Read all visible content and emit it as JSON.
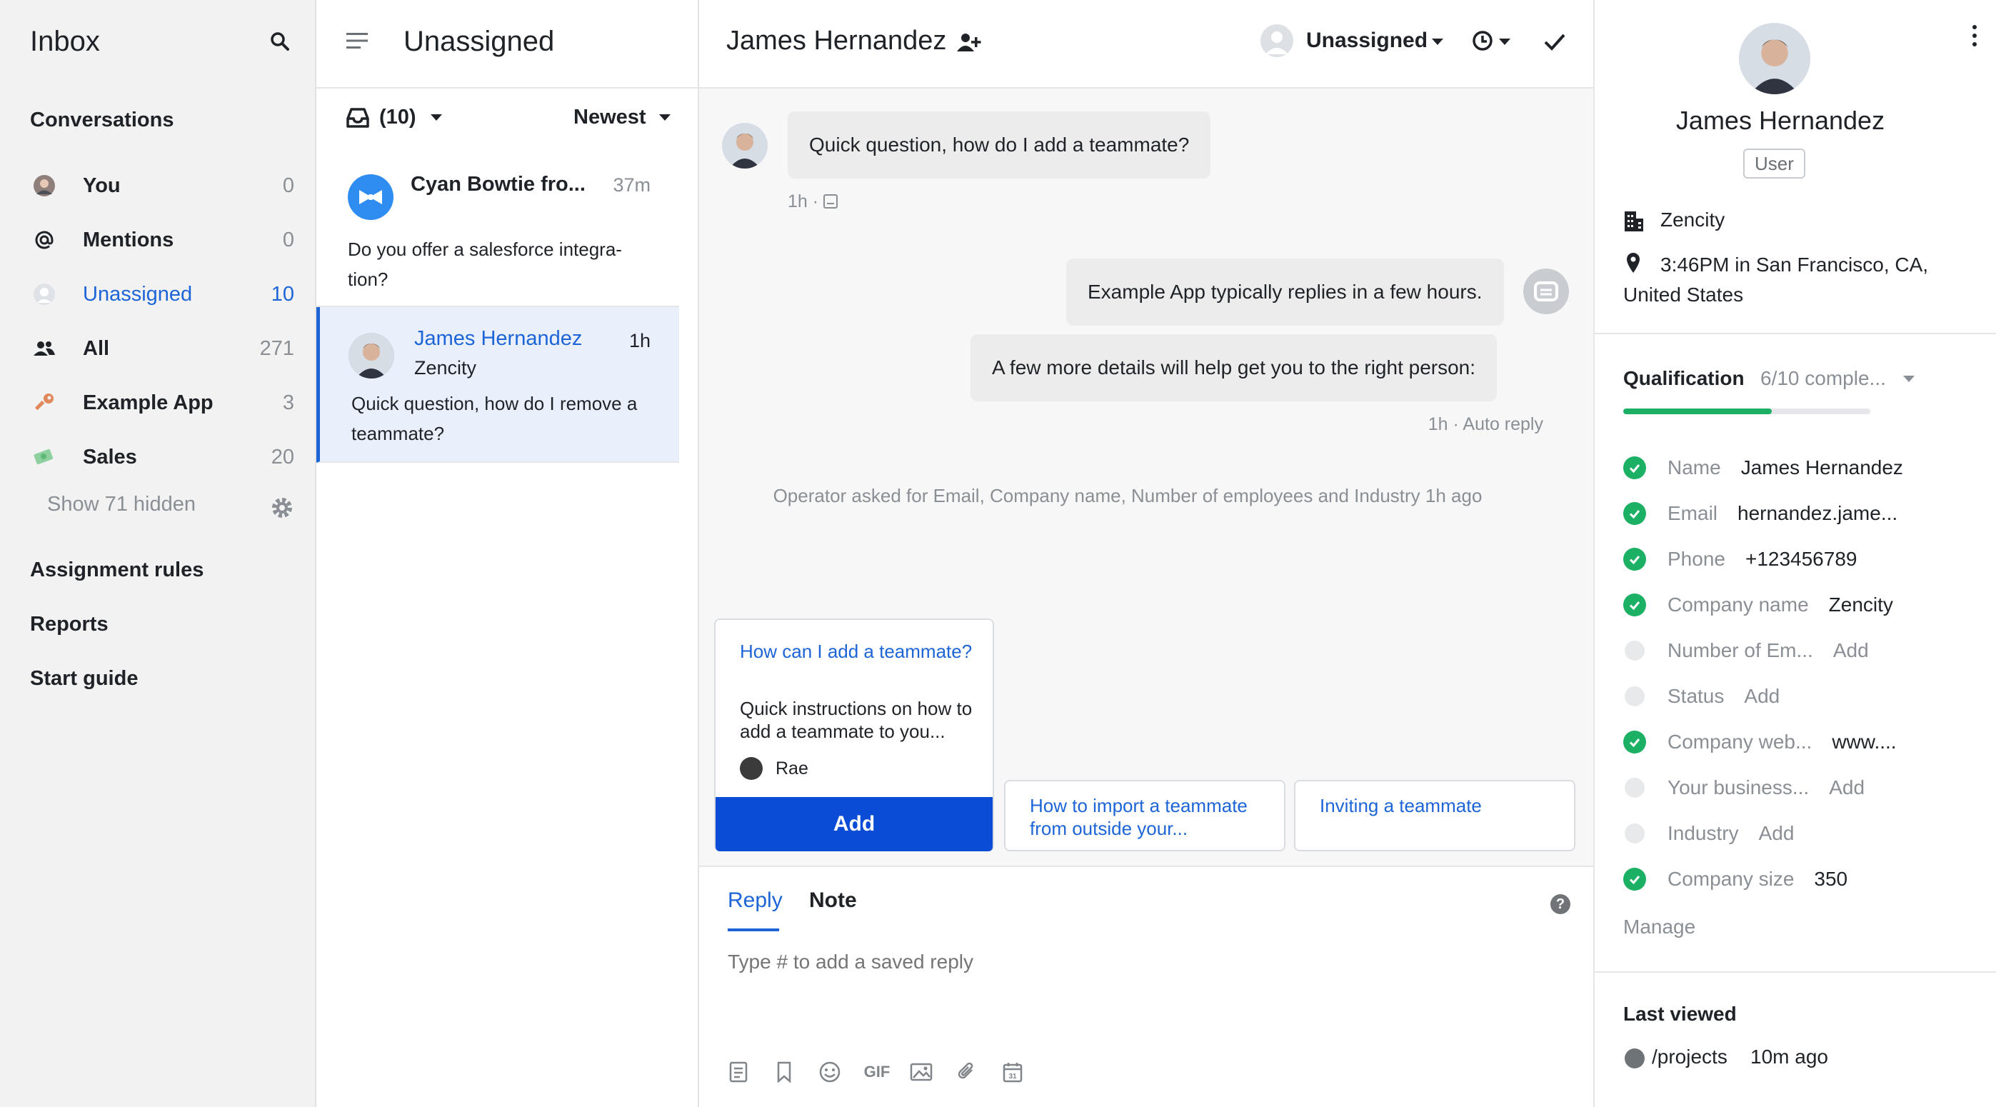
{
  "sidebar": {
    "title": "Inbox",
    "conversations_heading": "Conversations",
    "items": [
      {
        "label": "You",
        "count": "0",
        "icon": "user-avatar-icon"
      },
      {
        "label": "Mentions",
        "count": "0",
        "icon": "at-icon"
      },
      {
        "label": "Unassigned",
        "count": "10",
        "icon": "unassigned-avatar-icon"
      },
      {
        "label": "All",
        "count": "271",
        "icon": "team-icon"
      },
      {
        "label": "Example App",
        "count": "3",
        "icon": "key-icon"
      },
      {
        "label": "Sales",
        "count": "20",
        "icon": "money-icon"
      }
    ],
    "show_hidden": "Show 71 hidden",
    "assignment_rules": "Assignment rules",
    "reports": "Reports",
    "start_guide": "Start guide"
  },
  "list": {
    "title": "Unassigned",
    "tray_count": "(10)",
    "sort": "Newest",
    "conversations": [
      {
        "name": "Cyan Bowtie fro...",
        "time": "37m",
        "preview": "Do you offer a salesforce integra-tion?"
      },
      {
        "name": "James Hernandez",
        "company": "Zencity",
        "time": "1h",
        "preview": "Quick question, how do I remove a teammate?"
      }
    ]
  },
  "conversation": {
    "name": "James Hernandez",
    "assignee": "Unassigned",
    "messages": [
      {
        "text": "Quick question, how do I add a teammate?",
        "meta": "1h ·"
      },
      {
        "text": "Example App typically replies in a few hours."
      },
      {
        "text": "A few more details will help get you to the right person:",
        "meta": "1h · Auto reply"
      }
    ],
    "operator_note": "Operator asked for Email, Company name, Number of employees and Industry 1h ago",
    "suggestions": {
      "card1": {
        "title": "How can I add a teammate?",
        "desc": "Quick instructions on how to add a teammate to you...",
        "author": "Rae",
        "button": "Add"
      },
      "card2": {
        "title": "How to import a teammate from outside your..."
      },
      "card3": {
        "title": "Inviting a teammate"
      }
    },
    "composer": {
      "reply_tab": "Reply",
      "note_tab": "Note",
      "help": "?",
      "placeholder": "Type # to add a saved reply",
      "gif": "GIF",
      "calendar_day": "31"
    }
  },
  "details": {
    "name": "James Hernandez",
    "role": "User",
    "company": "Zencity",
    "local_time": "3:46PM in San Francisco, CA, United States",
    "qualification": {
      "title": "Qualification",
      "status": "6/10 comple...",
      "progress": 0.6,
      "attributes": [
        {
          "key": "Name",
          "value": "James Hernandez",
          "done": true
        },
        {
          "key": "Email",
          "value": "hernandez.jame...",
          "done": true
        },
        {
          "key": "Phone",
          "value": "+123456789",
          "done": true
        },
        {
          "key": "Company name",
          "value": "Zencity",
          "done": true
        },
        {
          "key": "Number of Em...",
          "value": "Add",
          "done": false
        },
        {
          "key": "Status",
          "value": "Add",
          "done": false
        },
        {
          "key": "Company web...",
          "value": "www....",
          "done": true
        },
        {
          "key": "Your business...",
          "value": "Add",
          "done": false
        },
        {
          "key": "Industry",
          "value": "Add",
          "done": false
        },
        {
          "key": "Company size",
          "value": "350",
          "done": true
        }
      ],
      "manage": "Manage"
    },
    "last_viewed": {
      "title": "Last viewed",
      "path": "/projects",
      "time": "10m ago"
    }
  },
  "colors": {
    "accent": "#1d65d6",
    "primary_button": "#0a4cd6",
    "success": "#1bb063",
    "muted": "#8a8f95"
  }
}
